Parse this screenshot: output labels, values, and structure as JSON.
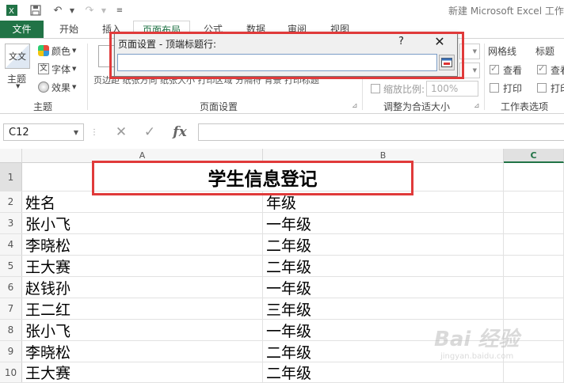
{
  "app": {
    "window_title": "新建 Microsoft Excel 工作"
  },
  "tabs": [
    {
      "label": "文件"
    },
    {
      "label": "开始"
    },
    {
      "label": "插入"
    },
    {
      "label": "页面布局"
    },
    {
      "label": "公式"
    },
    {
      "label": "数据"
    },
    {
      "label": "审阅"
    },
    {
      "label": "视图"
    }
  ],
  "ribbon": {
    "theme_group": {
      "label": "主题",
      "themes_button": "主题",
      "colors": "颜色",
      "fonts": "字体",
      "effects": "效果"
    },
    "page_setup_group": {
      "label": "页面设置",
      "buttons_row": "页边距  纸张方向  纸张大小  打印区域  分隔符   背景  打印标题"
    },
    "scale_group": {
      "label": "调整为合适大小",
      "scale_label": "缩放比例:",
      "scale_value": "100%"
    },
    "sheet_options_group": {
      "label": "工作表选项",
      "gridlines": "网格线",
      "headings": "标题",
      "view": "查看",
      "print": "打印"
    }
  },
  "dialog": {
    "title": "页面设置 - 顶端标题行:",
    "help": "?",
    "close": "✕",
    "input_value": ""
  },
  "formula_bar": {
    "name_box": "C12",
    "cancel": "✕",
    "enter": "✓",
    "fx": "fx",
    "formula": ""
  },
  "grid": {
    "columns": [
      "A",
      "B",
      "C"
    ],
    "title_row": {
      "row": "1",
      "text": "学生信息登记"
    },
    "rows": [
      {
        "row": "2",
        "a": "姓名",
        "b": "年级"
      },
      {
        "row": "3",
        "a": "张小飞",
        "b": "一年级"
      },
      {
        "row": "4",
        "a": "李晓松",
        "b": "二年级"
      },
      {
        "row": "5",
        "a": "王大赛",
        "b": "二年级"
      },
      {
        "row": "6",
        "a": "赵钱孙",
        "b": "一年级"
      },
      {
        "row": "7",
        "a": "王二红",
        "b": "三年级"
      },
      {
        "row": "8",
        "a": "张小飞",
        "b": "一年级"
      },
      {
        "row": "9",
        "a": "李晓松",
        "b": "二年级"
      },
      {
        "row": "10",
        "a": "王大赛",
        "b": "二年级"
      }
    ]
  },
  "watermark": {
    "text": "Bai 经验",
    "sub": "jingyan.baidu.com"
  },
  "colors": {
    "excel_green": "#217346",
    "annotation_red": "#e03a3a"
  }
}
